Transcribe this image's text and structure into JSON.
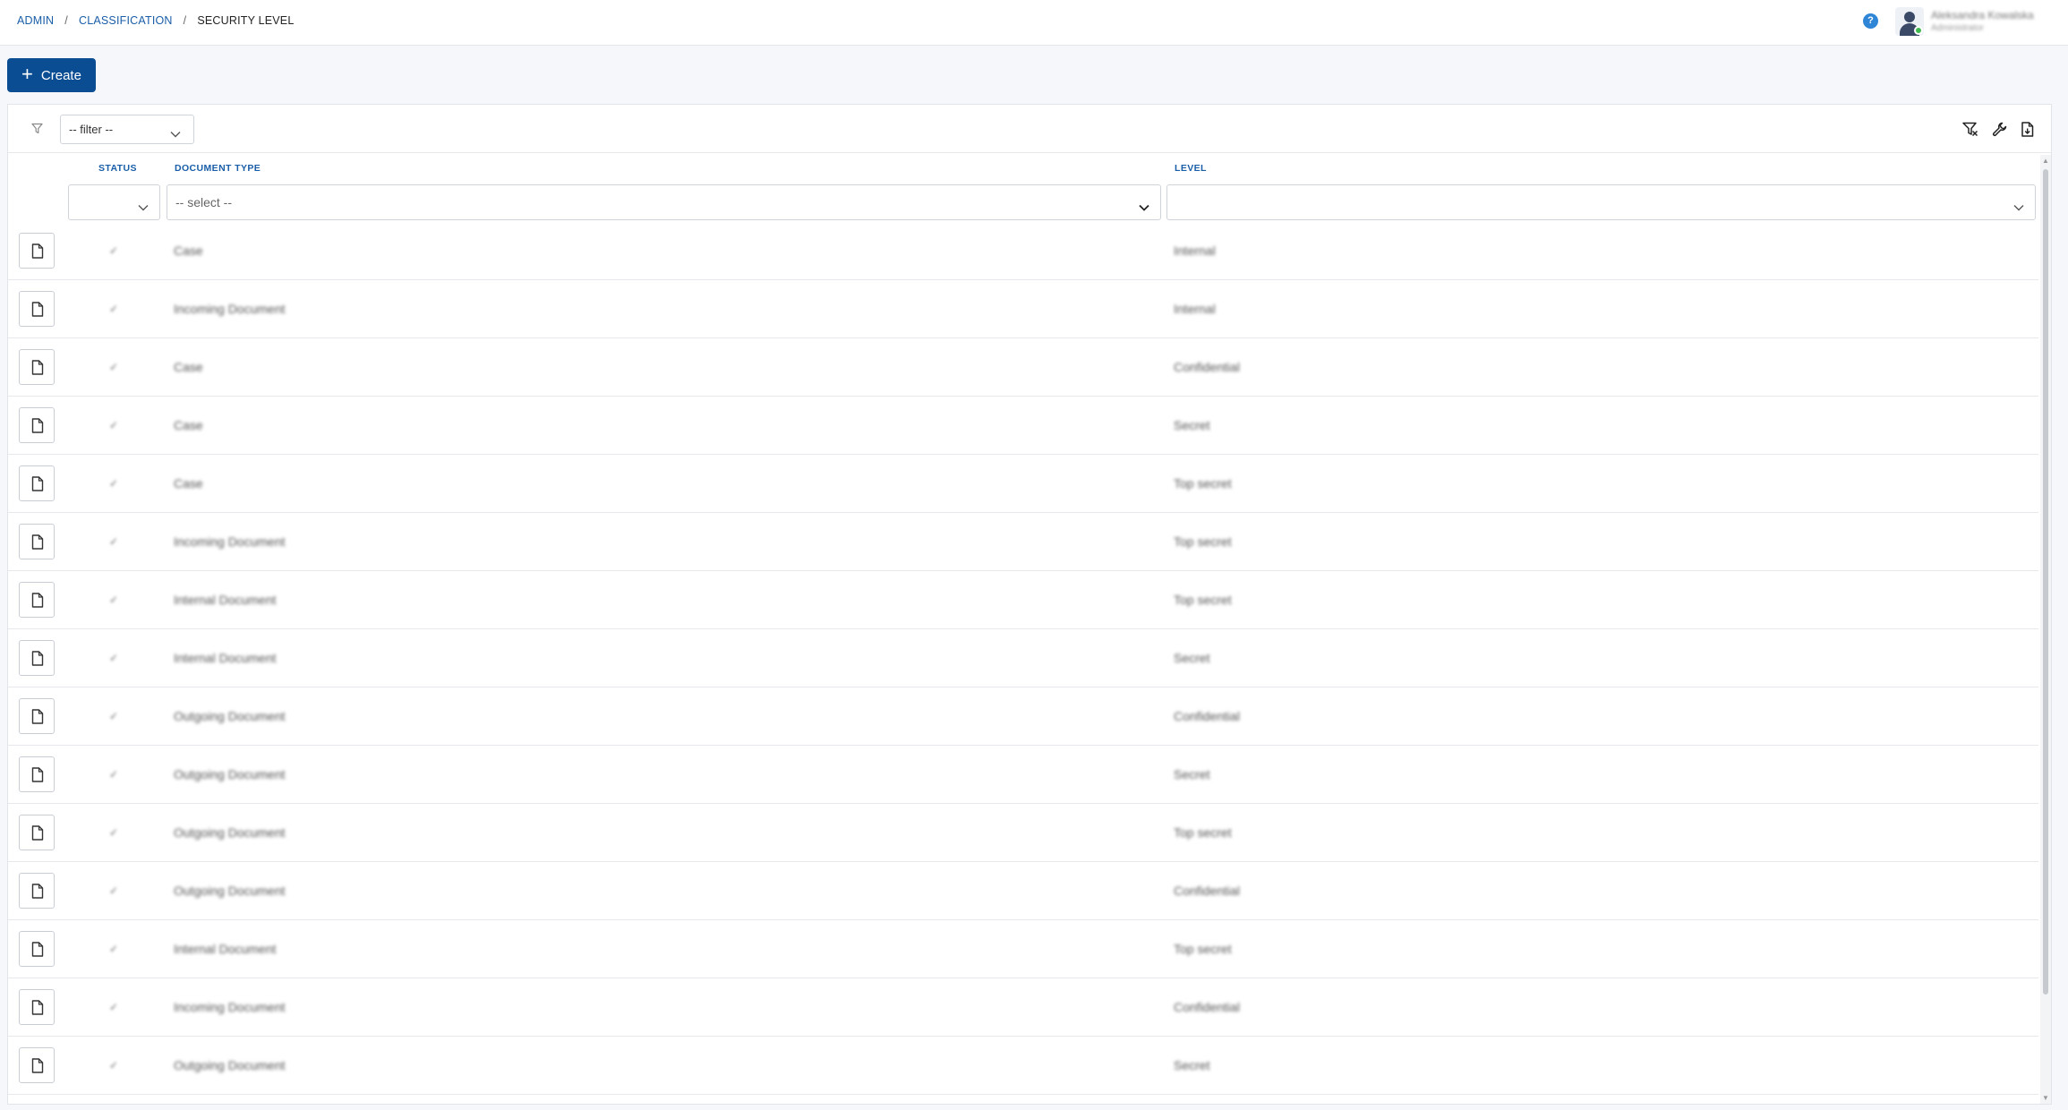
{
  "breadcrumb": {
    "admin": "ADMIN",
    "classification": "CLASSIFICATION",
    "current": "SECURITY LEVEL",
    "separator": "/"
  },
  "header": {
    "help_label": "?",
    "user_name": "Aleksandra Kowalska",
    "user_role": "Administrator"
  },
  "toolbar": {
    "create_label": "Create",
    "filter_placeholder": "-- filter --",
    "icons": [
      "clear-filter-icon",
      "wrench-icon",
      "export-document-icon"
    ]
  },
  "table": {
    "columns": {
      "status": "STATUS",
      "document_type": "DOCUMENT TYPE",
      "level": "LEVEL"
    },
    "filters": {
      "status_value": "",
      "document_type_placeholder": "-- select --",
      "level_value": ""
    },
    "rows": [
      {
        "status": "✓",
        "document_type": "Case",
        "level": "Internal"
      },
      {
        "status": "✓",
        "document_type": "Incoming Document",
        "level": "Internal"
      },
      {
        "status": "✓",
        "document_type": "Case",
        "level": "Confidential"
      },
      {
        "status": "✓",
        "document_type": "Case",
        "level": "Secret"
      },
      {
        "status": "✓",
        "document_type": "Case",
        "level": "Top secret"
      },
      {
        "status": "✓",
        "document_type": "Incoming Document",
        "level": "Top secret"
      },
      {
        "status": "✓",
        "document_type": "Internal Document",
        "level": "Top secret"
      },
      {
        "status": "✓",
        "document_type": "Internal Document",
        "level": "Secret"
      },
      {
        "status": "✓",
        "document_type": "Outgoing Document",
        "level": "Confidential"
      },
      {
        "status": "✓",
        "document_type": "Outgoing Document",
        "level": "Secret"
      },
      {
        "status": "✓",
        "document_type": "Outgoing Document",
        "level": "Top secret"
      },
      {
        "status": "✓",
        "document_type": "Outgoing Document",
        "level": "Confidential"
      },
      {
        "status": "✓",
        "document_type": "Internal Document",
        "level": "Top secret"
      },
      {
        "status": "✓",
        "document_type": "Incoming Document",
        "level": "Confidential"
      },
      {
        "status": "✓",
        "document_type": "Outgoing Document",
        "level": "Secret"
      }
    ]
  },
  "colors": {
    "primary": "#0b4d93",
    "link": "#1a5ea8",
    "help": "#2f86d6",
    "online": "#3fb950"
  }
}
